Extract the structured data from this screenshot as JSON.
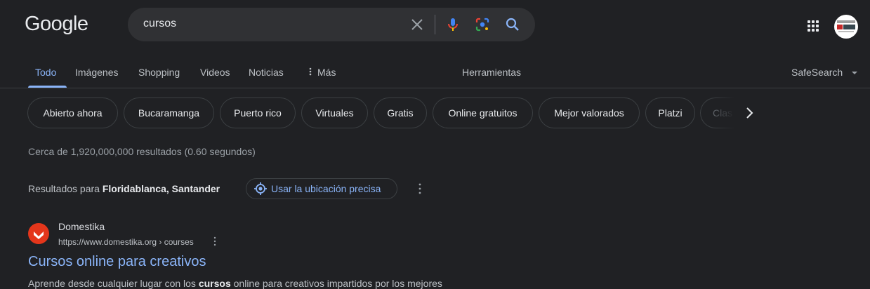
{
  "logo": "Google",
  "search": {
    "query": "cursos"
  },
  "tabs": [
    {
      "label": "Todo",
      "active": true
    },
    {
      "label": "Imágenes"
    },
    {
      "label": "Shopping"
    },
    {
      "label": "Videos"
    },
    {
      "label": "Noticias"
    },
    {
      "label": "Más"
    }
  ],
  "tools_label": "Herramientas",
  "safesearch_label": "SafeSearch",
  "chips": [
    "Abierto ahora",
    "Bucaramanga",
    "Puerto rico",
    "Virtuales",
    "Gratis",
    "Online gratuitos",
    "Mejor valorados",
    "Platzi",
    "Clas"
  ],
  "stats": "Cerca de 1,920,000,000 resultados (0.60 segundos)",
  "location": {
    "prefix": "Resultados para ",
    "place": "Floridablanca, Santander",
    "button": "Usar la ubicación precisa"
  },
  "result": {
    "site_name": "Domestika",
    "url": "https://www.domestika.org › courses",
    "title": "Cursos online para creativos",
    "snippet_before": "Aprende desde cualquier lugar con los ",
    "snippet_bold": "cursos",
    "snippet_after": " online para creativos impartidos por los mejores"
  },
  "colors": {
    "background": "#202124",
    "link": "#8ab4f8",
    "favicon": "#e4361b"
  },
  "icons": [
    "clear-icon",
    "mic-icon",
    "lens-icon",
    "search-icon",
    "apps-grid-icon",
    "more-vert-icon",
    "location-target-icon",
    "chevron-right-icon",
    "caret-down-icon"
  ]
}
